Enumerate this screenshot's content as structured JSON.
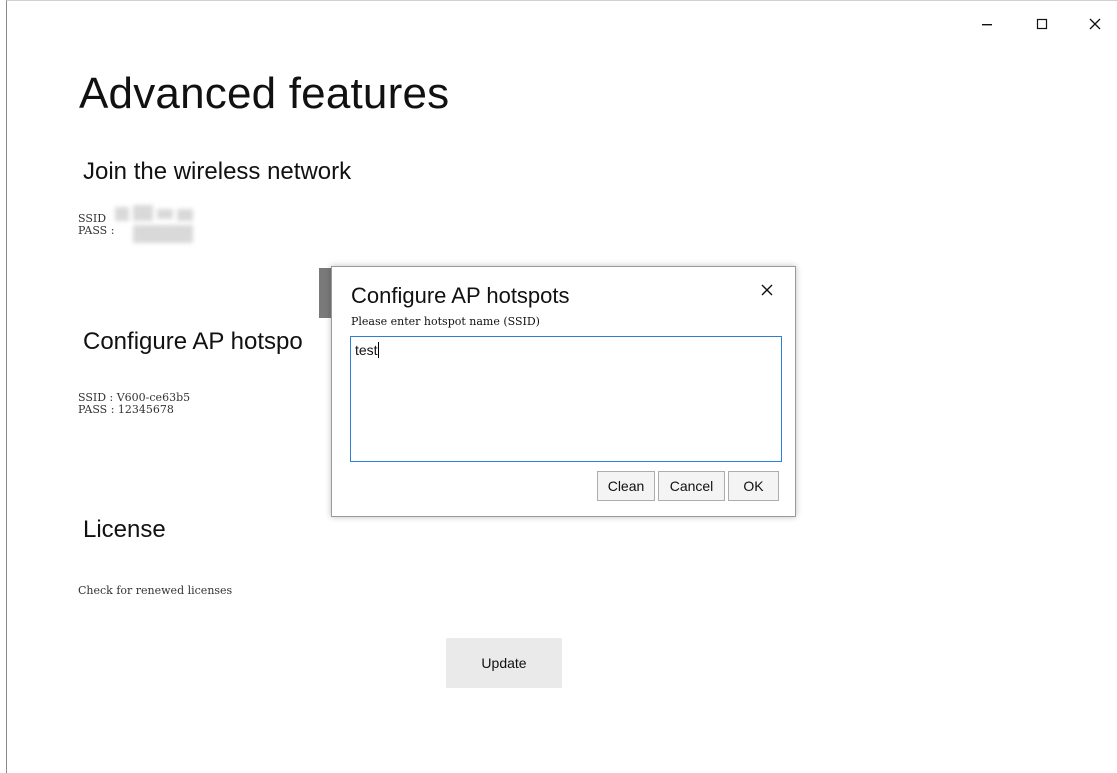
{
  "window": {
    "controls": {
      "minimize_icon": "minimize-icon",
      "maximize_icon": "maximize-icon",
      "close_icon": "close-icon"
    }
  },
  "page": {
    "title": "Advanced features"
  },
  "wireless": {
    "title": "Join the wireless network",
    "ssid_line": "SSID",
    "pass_line": "PASS : "
  },
  "ap": {
    "title": "Configure AP hotspo",
    "ssid_line": "SSID : V600-ce63b5",
    "pass_line": "PASS : 12345678"
  },
  "license": {
    "title": "License",
    "desc": "Check for renewed licenses",
    "update_label": "Update"
  },
  "dialog": {
    "title": "Configure AP hotspots",
    "prompt": "Please enter hotspot name (SSID)",
    "input_value": "test",
    "buttons": {
      "clean": "Clean",
      "cancel": "Cancel",
      "ok": "OK"
    }
  },
  "colors": {
    "input_focus_border": "#2f7fd1",
    "button_bg": "#eaeaea"
  }
}
